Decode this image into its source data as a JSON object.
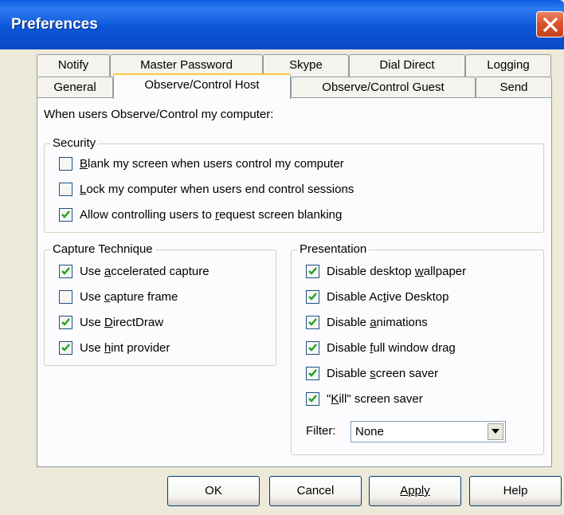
{
  "window": {
    "title": "Preferences"
  },
  "tabs_back": [
    "Notify",
    "Master Password",
    "Skype",
    "Dial Direct",
    "Logging"
  ],
  "tabs_front": [
    "General",
    "Observe/Control Host",
    "Observe/Control Guest",
    "Send"
  ],
  "active_tab": "Observe/Control Host",
  "panel": {
    "intro": "When users Observe/Control my computer:",
    "security": {
      "legend": "Security",
      "items": [
        {
          "pre": "",
          "accel": "B",
          "post": "lank my screen when users control my computer",
          "checked": false
        },
        {
          "pre": "",
          "accel": "L",
          "post": "ock my computer when users end control sessions",
          "checked": false
        },
        {
          "pre": "Allow controlling users to ",
          "accel": "r",
          "post": "equest screen blanking",
          "checked": true
        }
      ]
    },
    "capture": {
      "legend": "Capture Technique",
      "items": [
        {
          "pre": "Use ",
          "accel": "a",
          "post": "ccelerated capture",
          "checked": true
        },
        {
          "pre": "Use ",
          "accel": "c",
          "post": "apture frame",
          "checked": false
        },
        {
          "pre": "Use ",
          "accel": "D",
          "post": "irectDraw",
          "checked": true
        },
        {
          "pre": "Use ",
          "accel": "h",
          "post": "int provider",
          "checked": true
        }
      ]
    },
    "presentation": {
      "legend": "Presentation",
      "items": [
        {
          "pre": "Disable desktop ",
          "accel": "w",
          "post": "allpaper",
          "checked": true
        },
        {
          "pre": "Disable Ac",
          "accel": "t",
          "post": "ive Desktop",
          "checked": true
        },
        {
          "pre": "Disable ",
          "accel": "a",
          "post": "nimations",
          "checked": true
        },
        {
          "pre": "Disable ",
          "accel": "f",
          "post": "ull window drag",
          "checked": true
        },
        {
          "pre": "Disable ",
          "accel": "s",
          "post": "creen saver",
          "checked": true
        },
        {
          "pre": "\"",
          "accel": "K",
          "post": "ill\" screen saver",
          "checked": true
        }
      ],
      "filter_label": "Filter:",
      "filter_value": "None"
    }
  },
  "buttons": {
    "ok": "OK",
    "cancel": "Cancel",
    "apply": "Apply",
    "help": "Help"
  },
  "colors": {
    "titlebar": "#0A55D8",
    "dialog": "#ECE9D8",
    "panel": "#FCFCFE",
    "active_tab_accent": "#FFC83C",
    "close": "#D9552E"
  }
}
